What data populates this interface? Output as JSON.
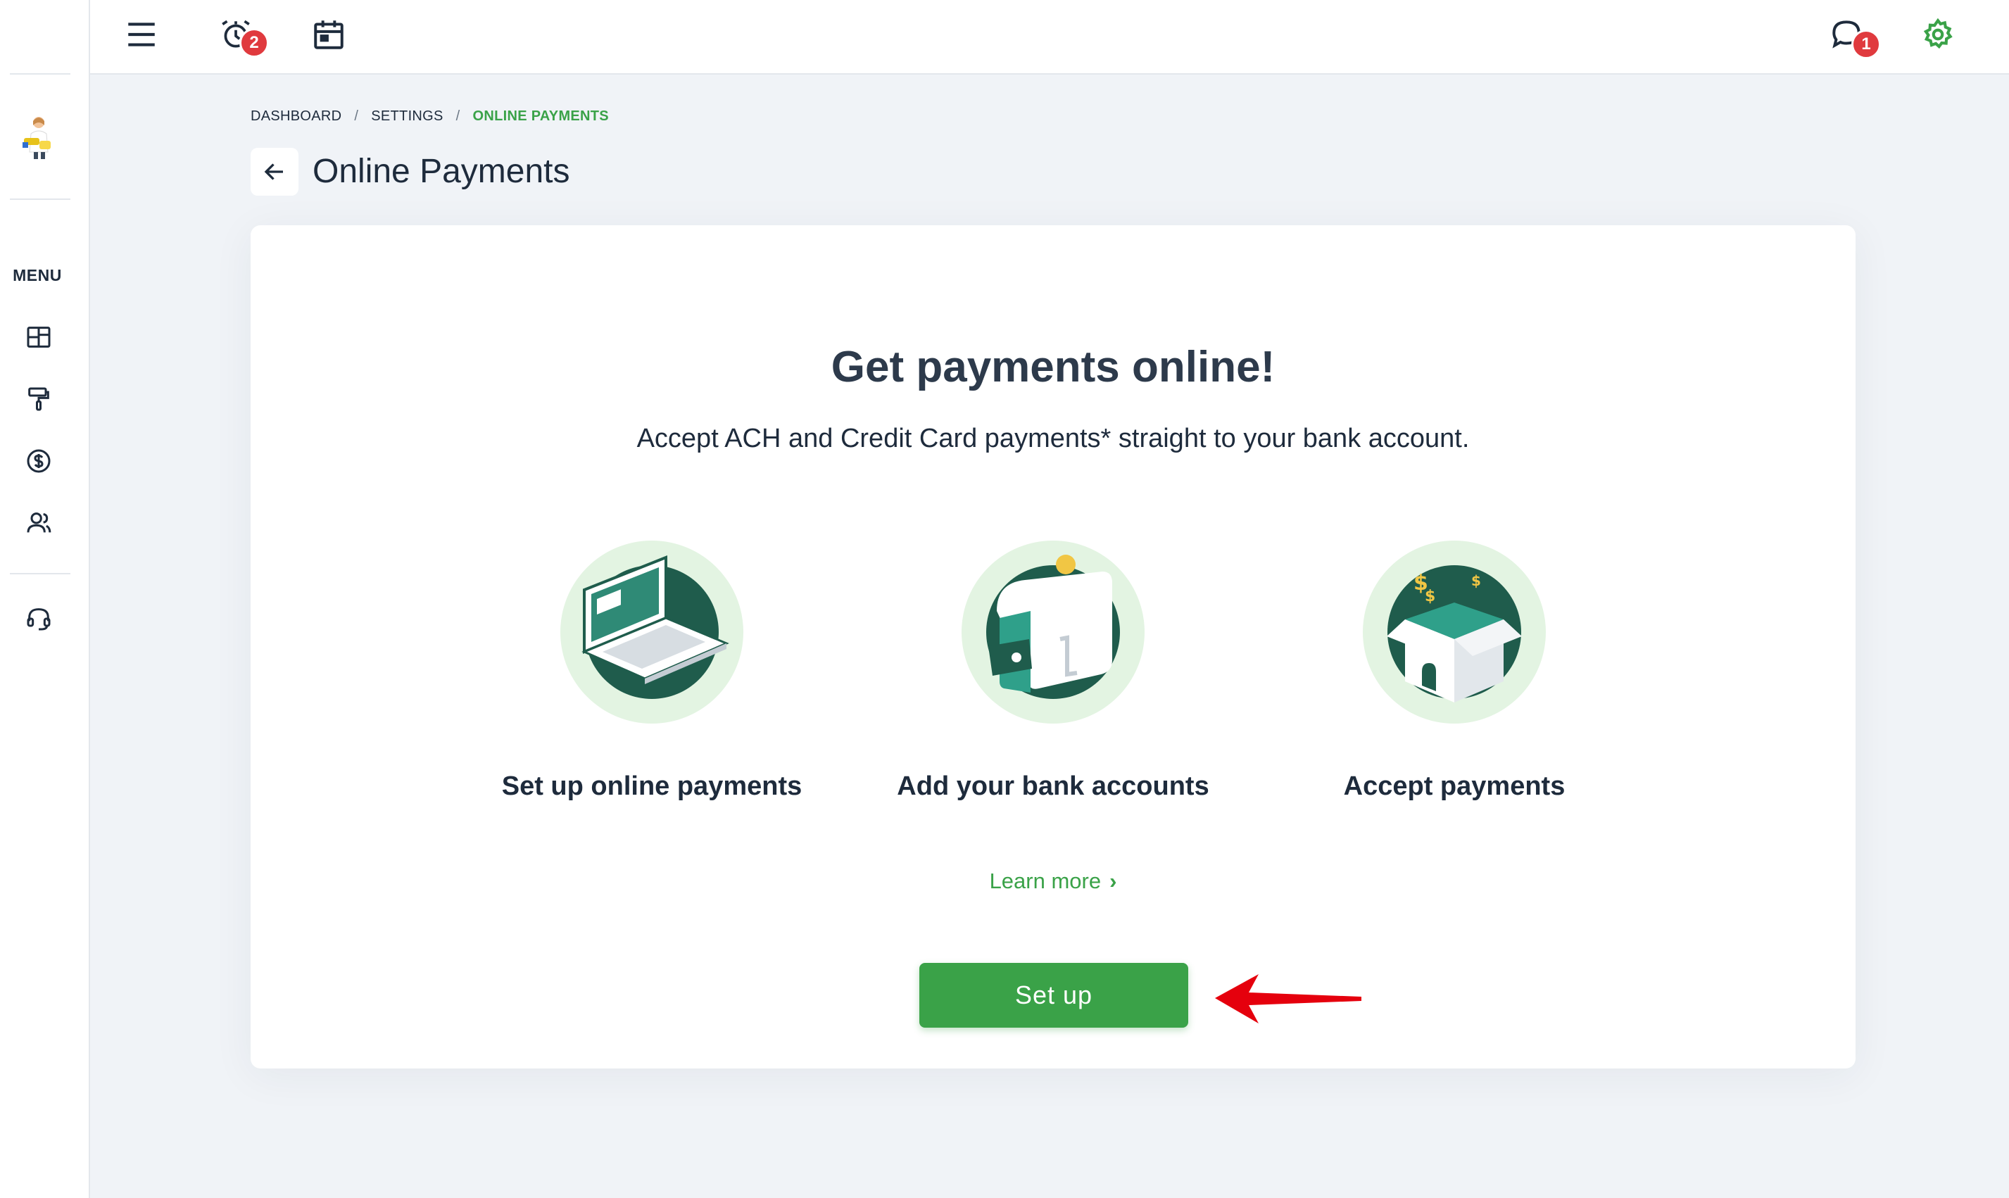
{
  "sidebar": {
    "menu_label": "MENU",
    "items": [
      {
        "icon": "dashboard-grid-icon"
      },
      {
        "icon": "paint-roller-icon"
      },
      {
        "icon": "dollar-circle-icon"
      },
      {
        "icon": "users-icon"
      },
      {
        "icon": "headset-support-icon"
      }
    ]
  },
  "topbar": {
    "alarm_badge": "2",
    "chat_badge": "1",
    "settings_color": "#3aa248"
  },
  "breadcrumb": {
    "items": [
      "DASHBOARD",
      "SETTINGS",
      "ONLINE PAYMENTS"
    ],
    "separator": "/"
  },
  "page": {
    "title": "Online Payments"
  },
  "card": {
    "title": "Get payments online!",
    "subtitle": "Accept ACH and Credit Card payments* straight to your bank account.",
    "steps": [
      {
        "label": "Set up online payments",
        "icon": "laptop-illustration"
      },
      {
        "label": "Add your bank accounts",
        "icon": "wallet-illustration"
      },
      {
        "label": "Accept payments",
        "icon": "open-box-illustration"
      }
    ],
    "learn_more": "Learn more",
    "setup_button": "Set up"
  },
  "colors": {
    "accent": "#3aa248",
    "badge": "#e03a3e",
    "dark_green": "#1f5c4c",
    "light_green": "#e3f4e2",
    "annotation_arrow": "#e5000d"
  }
}
